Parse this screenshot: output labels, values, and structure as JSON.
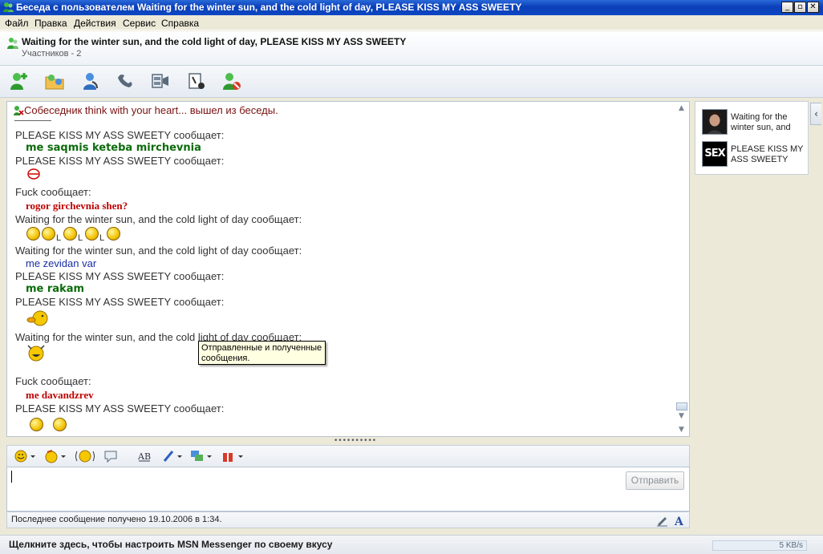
{
  "window": {
    "title": "Беседа с пользователем Waiting for the winter sun, and the cold light of day, PLEASE KISS MY ASS SWEETY",
    "min_btn": "_",
    "max_btn": "▫",
    "close_btn": "✕"
  },
  "menu": {
    "items": [
      "Файл",
      "Правка",
      "Действия",
      "Сервис",
      "Справка"
    ]
  },
  "conversation": {
    "title": "Waiting for the winter sun, and the cold light of day, PLEASE KISS MY ASS SWEETY",
    "participants": "Участников - 2"
  },
  "toolbar": {
    "icons": [
      "invite-contact-icon",
      "send-files-icon",
      "start-call-icon",
      "phone-icon",
      "video-icon",
      "games-icon",
      "block-icon"
    ]
  },
  "history": {
    "system_message": "Собеседник think with your heart... вышел из беседы.",
    "messages": [
      {
        "sender": "PLEASE KISS MY ASS SWEETY сообщает:",
        "text": "me saqmis keteba mirchevnia",
        "style": "green"
      },
      {
        "sender": "PLEASE KISS MY ASS SWEETY сообщает:",
        "text": "",
        "emoticon": "lips"
      },
      {
        "sender": "Fuck сообщает:",
        "text": "rogor girchevnia shen?",
        "style": "red"
      },
      {
        "sender": "Waiting for the winter sun, and the cold light of day сообщает:",
        "text": "",
        "emoticon": "rolling-laugh-row"
      },
      {
        "sender": "Waiting for the winter sun, and the cold light of day сообщает:",
        "text": "me zevidan var",
        "style": "blue"
      },
      {
        "sender": "PLEASE KISS MY ASS SWEETY сообщает:",
        "text": "me rakam",
        "style": "green"
      },
      {
        "sender": "PLEASE KISS MY ASS SWEETY сообщает:",
        "text": "",
        "emoticon": "kiss"
      },
      {
        "sender": "Waiting for the winter sun, and the cold light of day сообщает:",
        "text": "",
        "emoticon": "laugh"
      },
      {
        "sender": "Fuck сообщает:",
        "text": "me davandzrev",
        "style": "red"
      },
      {
        "sender": "PLEASE KISS MY ASS SWEETY сообщает:",
        "text": "",
        "emoticon": "two-smileys"
      }
    ],
    "rolling_separator": "L"
  },
  "tooltip": {
    "text_line1": "Отправленные и полученные",
    "text_line2": "сообщения."
  },
  "splitter": {
    "dots": "••••••••••"
  },
  "format_toolbar": {
    "icons": [
      "emoticons-icon",
      "winks-icon",
      "nudge-icon",
      "voice-clip-icon",
      "font-icon",
      "background-icon",
      "backgrounds-share-icon",
      "gifts-icon"
    ]
  },
  "input": {
    "value": "",
    "send_label": "Отправить"
  },
  "status": {
    "last_message": "Последнее сообщение получено 19.10.2006 в 1:34."
  },
  "contacts": [
    {
      "name": "Waiting for the winter sun, and",
      "picture": "portrait"
    },
    {
      "name": "PLEASE KISS MY ASS SWEETY",
      "picture": "sex-text"
    }
  ],
  "contact_picture_text": "SEX",
  "collapse": {
    "label": "‹"
  },
  "footer": {
    "customize_link": "Щелкните здесь, чтобы настроить MSN Messenger по своему вкусу",
    "speed": "5 KB/s"
  },
  "colors": {
    "titlebar": "#0a3fb9",
    "green_text": "#0b6b0b",
    "red_text": "#c00000",
    "blue_text": "#1a2fa0"
  }
}
